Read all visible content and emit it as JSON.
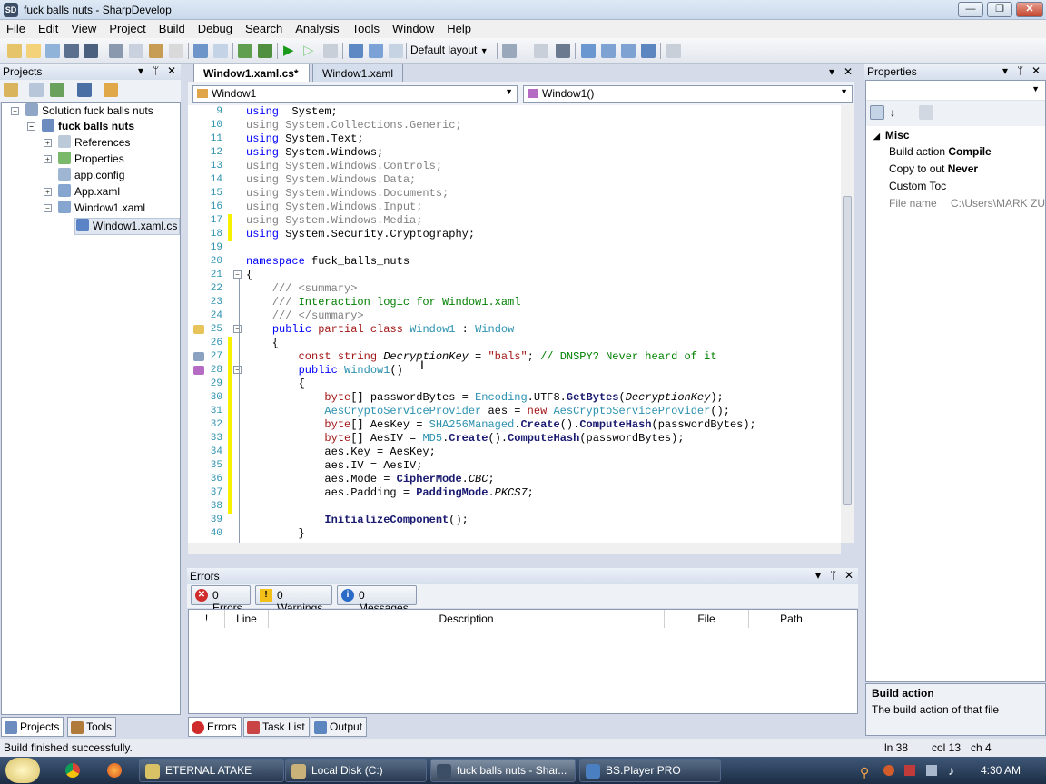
{
  "window": {
    "title": "fuck balls nuts - SharpDevelop",
    "app_icon": "SD"
  },
  "title_buttons": {
    "minimize": "—",
    "maximize": "❐",
    "close": "✕"
  },
  "menu": [
    "File",
    "Edit",
    "View",
    "Project",
    "Build",
    "Debug",
    "Search",
    "Analysis",
    "Tools",
    "Window",
    "Help"
  ],
  "toolbar": {
    "layout": "Default layout"
  },
  "projects": {
    "title": "Projects",
    "tree": [
      {
        "label": "Solution fuck balls nuts",
        "bold": false
      },
      {
        "label": "fuck balls nuts",
        "bold": true
      },
      {
        "label": "References",
        "bold": false
      },
      {
        "label": "Properties",
        "bold": false
      },
      {
        "label": "app.config",
        "bold": false
      },
      {
        "label": "App.xaml",
        "bold": false
      },
      {
        "label": "Window1.xaml",
        "bold": false
      },
      {
        "label": "Window1.xaml.cs",
        "bold": false
      }
    ],
    "tabs": [
      "Projects",
      "Tools"
    ]
  },
  "editor": {
    "tabs": [
      "Window1.xaml.cs*",
      "Window1.xaml"
    ],
    "class_combo": "Window1",
    "member_combo": "Window1()",
    "lines": [
      {
        "n": "9",
        "segs": [
          [
            "kw",
            "using"
          ],
          [
            "",
            "  System;"
          ]
        ]
      },
      {
        "n": "10",
        "segs": [
          [
            "gray",
            "using System.Collections.Generic;"
          ]
        ]
      },
      {
        "n": "11",
        "segs": [
          [
            "kw",
            "using"
          ],
          [
            "",
            " System.Text;"
          ]
        ]
      },
      {
        "n": "12",
        "segs": [
          [
            "kw",
            "using"
          ],
          [
            "",
            " System.Windows;"
          ]
        ]
      },
      {
        "n": "13",
        "segs": [
          [
            "gray",
            "using System.Windows.Controls;"
          ]
        ]
      },
      {
        "n": "14",
        "segs": [
          [
            "gray",
            "using System.Windows.Data;"
          ]
        ]
      },
      {
        "n": "15",
        "segs": [
          [
            "gray",
            "using System.Windows.Documents;"
          ]
        ]
      },
      {
        "n": "16",
        "segs": [
          [
            "gray",
            "using System.Windows.Input;"
          ]
        ]
      },
      {
        "n": "17",
        "segs": [
          [
            "gray",
            "using System.Windows.Media;"
          ]
        ]
      },
      {
        "n": "18",
        "segs": [
          [
            "kw",
            "using"
          ],
          [
            "",
            " System.Security.Cryptography;"
          ]
        ]
      },
      {
        "n": "19",
        "segs": []
      },
      {
        "n": "20",
        "segs": [
          [
            "kw",
            "namespace"
          ],
          [
            "",
            " fuck_balls_nuts"
          ]
        ]
      },
      {
        "n": "21",
        "segs": [
          [
            "",
            "{"
          ]
        ]
      },
      {
        "n": "22",
        "segs": [
          [
            "gray",
            "    /// <summary>"
          ]
        ]
      },
      {
        "n": "23",
        "segs": [
          [
            "gray",
            "    /// "
          ],
          [
            "cmt",
            "Interaction logic for Window1.xaml"
          ]
        ]
      },
      {
        "n": "24",
        "segs": [
          [
            "gray",
            "    /// </summary>"
          ]
        ]
      },
      {
        "n": "25",
        "segs": [
          [
            "",
            "    "
          ],
          [
            "kw",
            "public"
          ],
          [
            "",
            " "
          ],
          [
            "str",
            "partial class"
          ],
          [
            "",
            " "
          ],
          [
            "type",
            "Window1"
          ],
          [
            "",
            " : "
          ],
          [
            "type",
            "Window"
          ]
        ]
      },
      {
        "n": "26",
        "segs": [
          [
            "",
            "    {"
          ]
        ]
      },
      {
        "n": "27",
        "segs": [
          [
            "",
            "        "
          ],
          [
            "str",
            "const string"
          ],
          [
            "",
            " "
          ],
          [
            "ital",
            "DecryptionKey"
          ],
          [
            "",
            " = "
          ],
          [
            "str",
            "\"bals\""
          ],
          [
            "",
            ";"
          ],
          [
            "cmt",
            " // DNSPY? Never heard of it"
          ]
        ]
      },
      {
        "n": "28",
        "segs": [
          [
            "",
            "        "
          ],
          [
            "kw",
            "public"
          ],
          [
            "",
            " "
          ],
          [
            "type",
            "Window1"
          ],
          [
            "",
            "()"
          ]
        ]
      },
      {
        "n": "29",
        "segs": [
          [
            "",
            "        {"
          ]
        ]
      },
      {
        "n": "30",
        "segs": [
          [
            "",
            "            "
          ],
          [
            "str",
            "byte"
          ],
          [
            "",
            "[] passwordBytes = "
          ],
          [
            "type",
            "Encoding"
          ],
          [
            "",
            ".UTF8."
          ],
          [
            "methd",
            "GetBytes"
          ],
          [
            "",
            "("
          ],
          [
            "ital",
            "DecryptionKey"
          ],
          [
            "",
            ");"
          ]
        ]
      },
      {
        "n": "31",
        "segs": [
          [
            "",
            "            "
          ],
          [
            "type",
            "AesCryptoServiceProvider"
          ],
          [
            "",
            " aes = "
          ],
          [
            "str",
            "new"
          ],
          [
            "",
            " "
          ],
          [
            "type",
            "AesCryptoServiceProvider"
          ],
          [
            "",
            "();"
          ]
        ]
      },
      {
        "n": "32",
        "segs": [
          [
            "",
            "            "
          ],
          [
            "str",
            "byte"
          ],
          [
            "",
            "[] AesKey = "
          ],
          [
            "type",
            "SHA256Managed"
          ],
          [
            "",
            "."
          ],
          [
            "methd",
            "Create"
          ],
          [
            "",
            "()."
          ],
          [
            "methd",
            "ComputeHash"
          ],
          [
            "",
            "(passwordBytes);"
          ]
        ]
      },
      {
        "n": "33",
        "segs": [
          [
            "",
            "            "
          ],
          [
            "str",
            "byte"
          ],
          [
            "",
            "[] AesIV = "
          ],
          [
            "type",
            "MD5"
          ],
          [
            "",
            "."
          ],
          [
            "methd",
            "Create"
          ],
          [
            "",
            "()."
          ],
          [
            "methd",
            "ComputeHash"
          ],
          [
            "",
            "(passwordBytes);"
          ]
        ]
      },
      {
        "n": "34",
        "segs": [
          [
            "",
            "            aes.Key = AesKey;"
          ]
        ]
      },
      {
        "n": "35",
        "segs": [
          [
            "",
            "            aes.IV = AesIV;"
          ]
        ]
      },
      {
        "n": "36",
        "segs": [
          [
            "",
            "            aes.Mode = "
          ],
          [
            "methd",
            "CipherMode"
          ],
          [
            "",
            "."
          ],
          [
            "ital",
            "CBC"
          ],
          [
            "",
            ";"
          ]
        ]
      },
      {
        "n": "37",
        "segs": [
          [
            "",
            "            aes.Padding = "
          ],
          [
            "methd",
            "PaddingMode"
          ],
          [
            "",
            "."
          ],
          [
            "ital",
            "PKCS7"
          ],
          [
            "",
            ";"
          ]
        ]
      },
      {
        "n": "38",
        "segs": []
      },
      {
        "n": "39",
        "segs": [
          [
            "",
            "            "
          ],
          [
            "methd",
            "InitializeComponent"
          ],
          [
            "",
            "();"
          ]
        ]
      },
      {
        "n": "40",
        "segs": [
          [
            "",
            "        }"
          ]
        ]
      }
    ]
  },
  "errors": {
    "title": "Errors",
    "filters": [
      "0 Errors",
      "0 Warnings",
      "0 Messages"
    ],
    "columns": [
      "!",
      "Line",
      "Description",
      "File",
      "Path"
    ],
    "tabs": [
      "Errors",
      "Task List",
      "Output"
    ]
  },
  "properties": {
    "title": "Properties",
    "category": "Misc",
    "rows": [
      {
        "name": "Build action",
        "value": "Compile",
        "bold": true
      },
      {
        "name": "Copy to out",
        "value": "Never",
        "bold": true
      },
      {
        "name": "Custom Toc",
        "value": "",
        "bold": false
      },
      {
        "name": "File name",
        "value": "C:\\Users\\MARK ZU",
        "bold": false
      }
    ],
    "help_title": "Build action",
    "help_text": "The build action of that file"
  },
  "status": {
    "message": "Build finished successfully.",
    "line": "ln 38",
    "col": "col 13",
    "ch": "ch 4"
  },
  "taskbar": {
    "items": [
      "ETERNAL ATAKE",
      "Local Disk (C:)",
      "fuck balls nuts - Shar...",
      "BS.Player PRO"
    ],
    "clock": "4:30 AM"
  },
  "colors": {
    "keyword": "#0000ff",
    "type": "#2b91af",
    "string": "#a31515",
    "comment": "#008000",
    "line_number": "#2b91af"
  }
}
